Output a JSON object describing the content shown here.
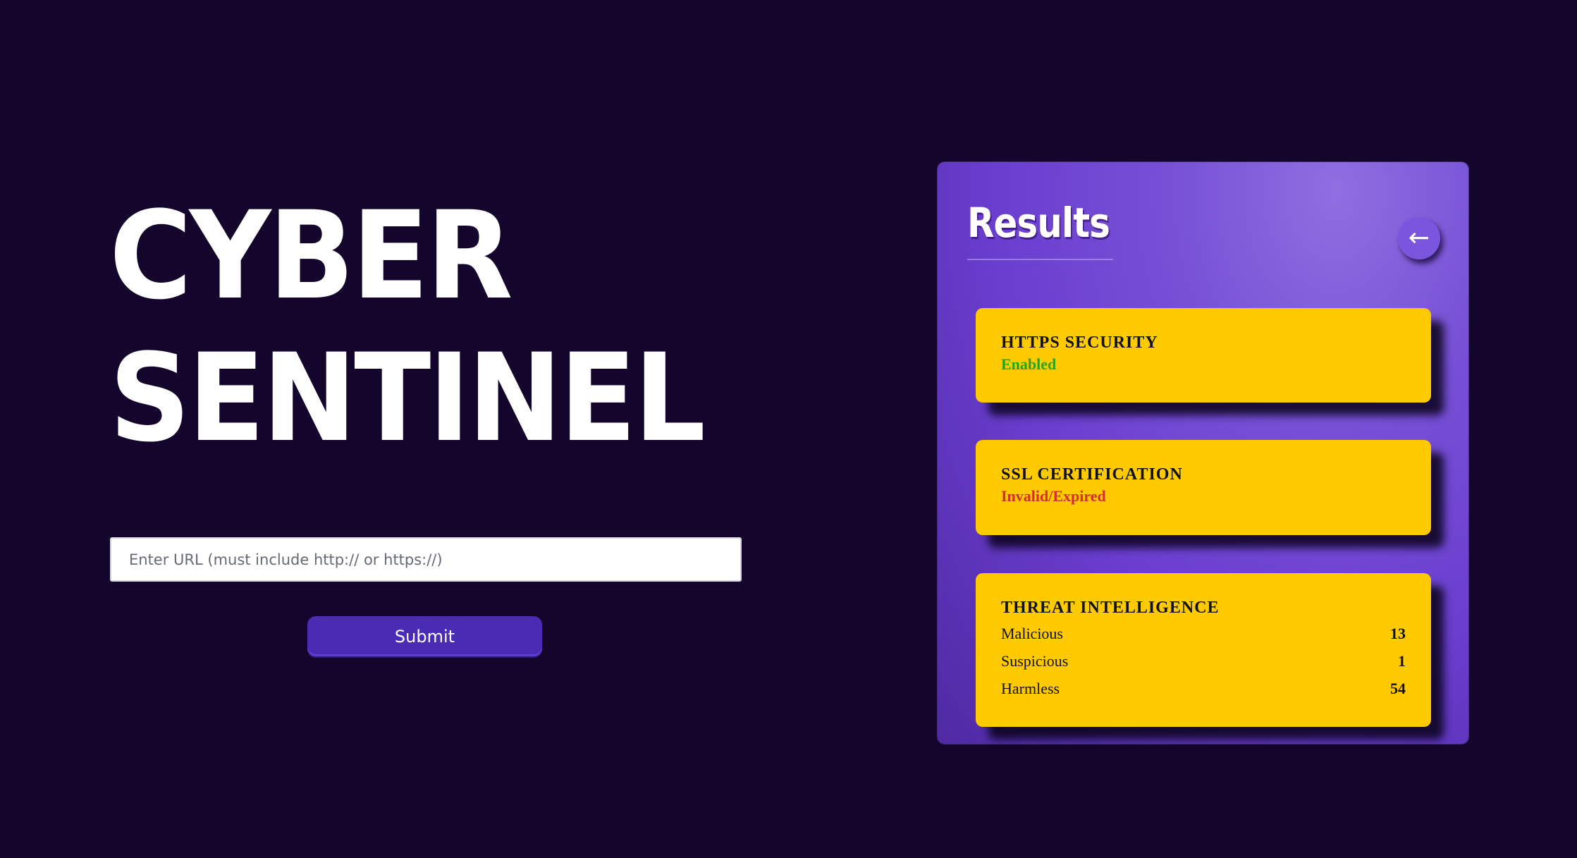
{
  "app": {
    "title_line1": "CYBER",
    "title_line2": "SENTINEL"
  },
  "form": {
    "url_placeholder": "Enter URL (must include http:// or https://)",
    "url_value": "",
    "submit_label": "Submit"
  },
  "results": {
    "title": "Results",
    "back_icon": "←",
    "https": {
      "title": "HTTPS SECURITY",
      "status": "Enabled"
    },
    "ssl": {
      "title": "SSL CERTIFICATION",
      "status": "Invalid/Expired"
    },
    "threat": {
      "title": "THREAT INTELLIGENCE",
      "rows": [
        {
          "label": "Malicious",
          "value": "13"
        },
        {
          "label": "Suspicious",
          "value": "1"
        },
        {
          "label": "Harmless",
          "value": "54"
        }
      ]
    }
  },
  "colors": {
    "background": "#13052b",
    "accent": "#4a2bb4",
    "panel": "#6a3ecf",
    "card": "#ffcb00",
    "status_ok": "#2aa31a",
    "status_bad": "#d42f2f"
  }
}
